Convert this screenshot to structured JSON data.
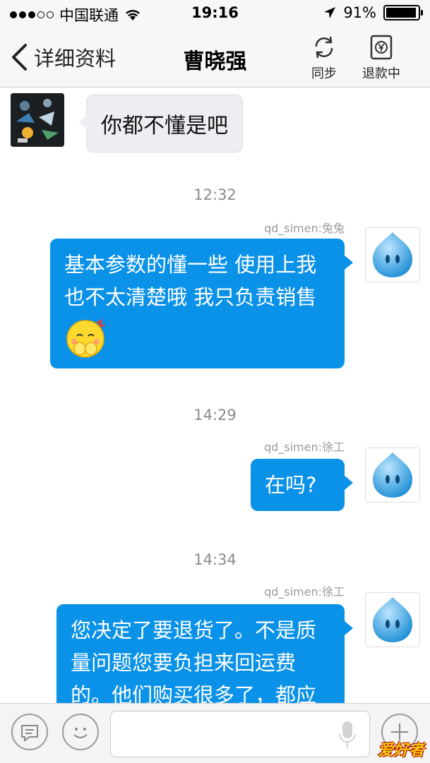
{
  "status_bar": {
    "carrier": "中国联通",
    "time": "19:16",
    "battery": "91%"
  },
  "nav": {
    "back_label": "详细资料",
    "title": "曹晓强",
    "sync_label": "同步",
    "refund_label": "退款中"
  },
  "chat": {
    "incoming_message": "你都不懂是吧",
    "time1": "12:32",
    "sender1": "qd_simen:兔兔",
    "msg1_lines": [
      "基本参数的懂一些 使用上我",
      "也不太清楚哦 我只负责销售"
    ],
    "time2": "14:29",
    "sender2": "qd_simen:徐工",
    "msg2": "在吗?",
    "time3": "14:34",
    "sender3": "qd_simen:徐工",
    "msg3_lines": [
      "您决定了要退货了。不是质",
      "量问题您要负担来回运费",
      "的。他们购买很多了，都应"
    ]
  },
  "input_bar": {
    "watermark": "爱好者"
  },
  "colors": {
    "outgoing_bubble": "#0a91e8",
    "incoming_bubble": "#eceef2"
  }
}
